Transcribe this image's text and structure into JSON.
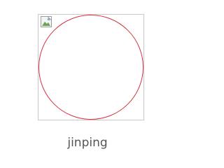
{
  "thumbnail": {
    "icon": "broken-image-icon",
    "border_color": "#c8c8c8",
    "circle_color": "#d5303e"
  },
  "caption": {
    "label": "jinping",
    "color": "#555555"
  }
}
